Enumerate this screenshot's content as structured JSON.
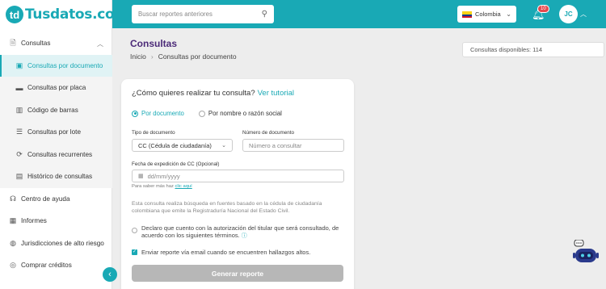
{
  "brand": {
    "logo_mark": "td",
    "name": "Tusdatos.co",
    "accent": "#19a9b5",
    "title_color": "#4b2a78"
  },
  "sidebar": {
    "items": [
      {
        "label": "Consultas",
        "icon": "document-search-icon"
      },
      {
        "label": "Consultas por documento",
        "icon": "id-card-icon",
        "active": true
      },
      {
        "label": "Consultas por placa",
        "icon": "car-icon"
      },
      {
        "label": "Código de barras",
        "icon": "barcode-icon"
      },
      {
        "label": "Consultas por lote",
        "icon": "batch-icon"
      },
      {
        "label": "Consultas recurrentes",
        "icon": "recurring-icon"
      },
      {
        "label": "Histórico de consultas",
        "icon": "history-icon"
      },
      {
        "label": "Centro de ayuda",
        "icon": "headset-icon"
      },
      {
        "label": "Informes",
        "icon": "reports-icon"
      },
      {
        "label": "Jurisdicciones de alto riesgo",
        "icon": "globe-icon"
      },
      {
        "label": "Comprar créditos",
        "icon": "coin-icon"
      }
    ]
  },
  "header": {
    "search_placeholder": "Buscar reportes anteriores",
    "country": "Colombia",
    "notification_count": "10",
    "avatar_initials": "JC"
  },
  "page": {
    "title": "Consultas",
    "breadcrumb": [
      "Inicio",
      "Consultas por documento"
    ],
    "credits_text": "Consultas disponibles: 114"
  },
  "form": {
    "question": "¿Cómo quieres realizar tu consulta?",
    "tutorial_link": "Ver tutorial",
    "radio_document": "Por documento",
    "radio_name": "Por nombre o razón social",
    "doc_type_label": "Tipo de documento",
    "doc_type_value": "CC (Cédula de ciudadanía)",
    "doc_number_label": "Número de documento",
    "doc_number_placeholder": "Número a consultar",
    "date_label": "Fecha de expedición de CC (Opcional)",
    "date_placeholder": "dd/mm/yyyy",
    "hint_text": "Para saber más haz",
    "hint_link": "clic aquí",
    "description": "Esta consulta realiza búsqueda en fuentes basado en la cédula de ciudadanía colombiana que emite la Registraduría Nacional del Estado Civil.",
    "consent_text": "Declaro que cuento con la autorización del titular que será consultado, de acuerdo con los siguientes términos.",
    "email_text": "Enviar reporte vía email cuando se encuentren hallazgos altos.",
    "submit_label": "Generar reporte"
  }
}
